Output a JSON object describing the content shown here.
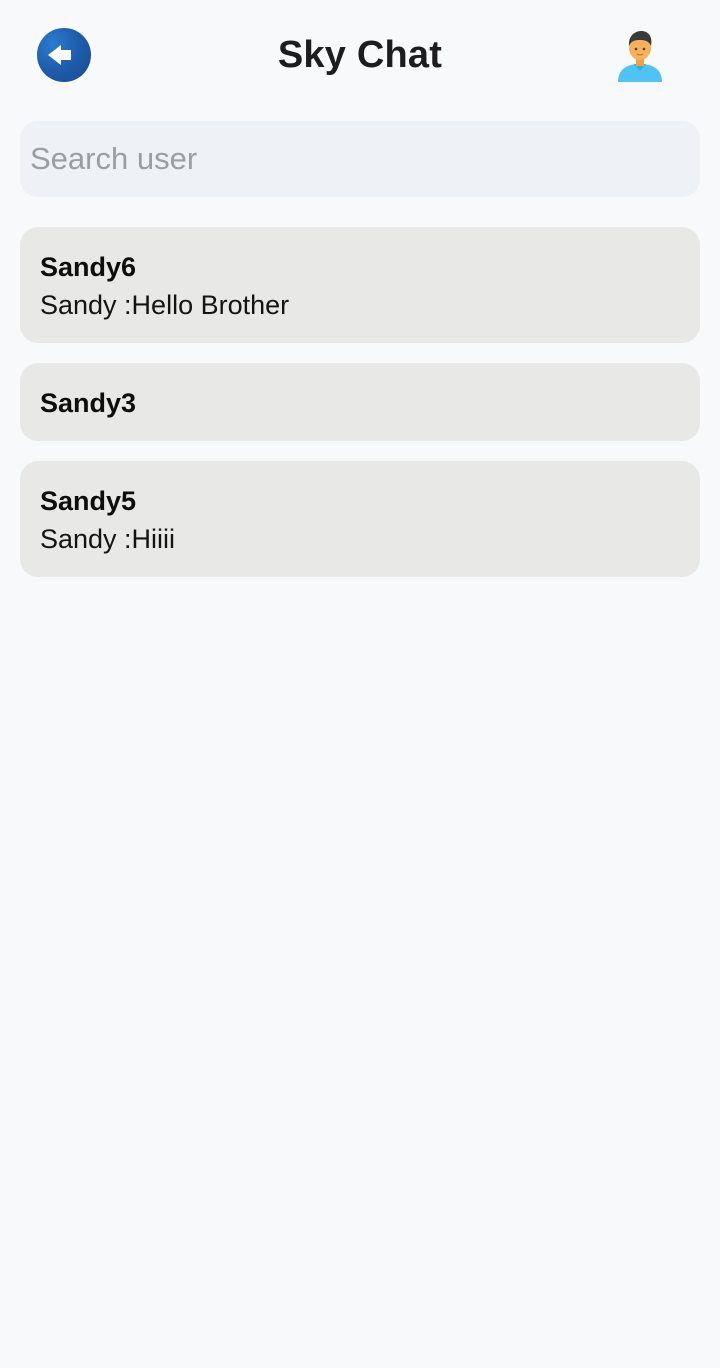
{
  "header": {
    "title": "Sky Chat",
    "back_icon": "back-arrow-icon",
    "profile_icon": "user-avatar-icon"
  },
  "search": {
    "placeholder": "Search user",
    "value": ""
  },
  "chats": [
    {
      "name": "Sandy6",
      "last_message": "Sandy :Hello Brother"
    },
    {
      "name": "Sandy3",
      "last_message": ""
    },
    {
      "name": "Sandy5",
      "last_message": "Sandy :Hiiii"
    }
  ],
  "colors": {
    "background": "#f8f9fb",
    "card": "#e8e8e7",
    "search_bg": "#eef2f6",
    "accent": "#1f5fae"
  }
}
